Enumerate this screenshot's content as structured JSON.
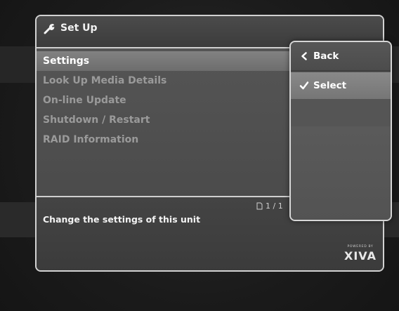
{
  "window": {
    "title": "Set Up",
    "title_icon": "wrench-icon"
  },
  "menu": {
    "items": [
      {
        "label": "Settings",
        "selected": true
      },
      {
        "label": "Look Up Media Details",
        "selected": false
      },
      {
        "label": "On-line Update",
        "selected": false
      },
      {
        "label": "Shutdown / Restart",
        "selected": false
      },
      {
        "label": "RAID Information",
        "selected": false
      }
    ]
  },
  "info": {
    "description": "Change the settings of this unit",
    "page": "1 / 1",
    "page_icon": "page-icon"
  },
  "side_menu": {
    "items": [
      {
        "label": "Back",
        "icon": "chevron-left-icon"
      },
      {
        "label": "Select",
        "icon": "checkmark-icon",
        "selected": true
      }
    ]
  },
  "brand": {
    "tagline": "POWERED BY",
    "name": "XIVA"
  }
}
